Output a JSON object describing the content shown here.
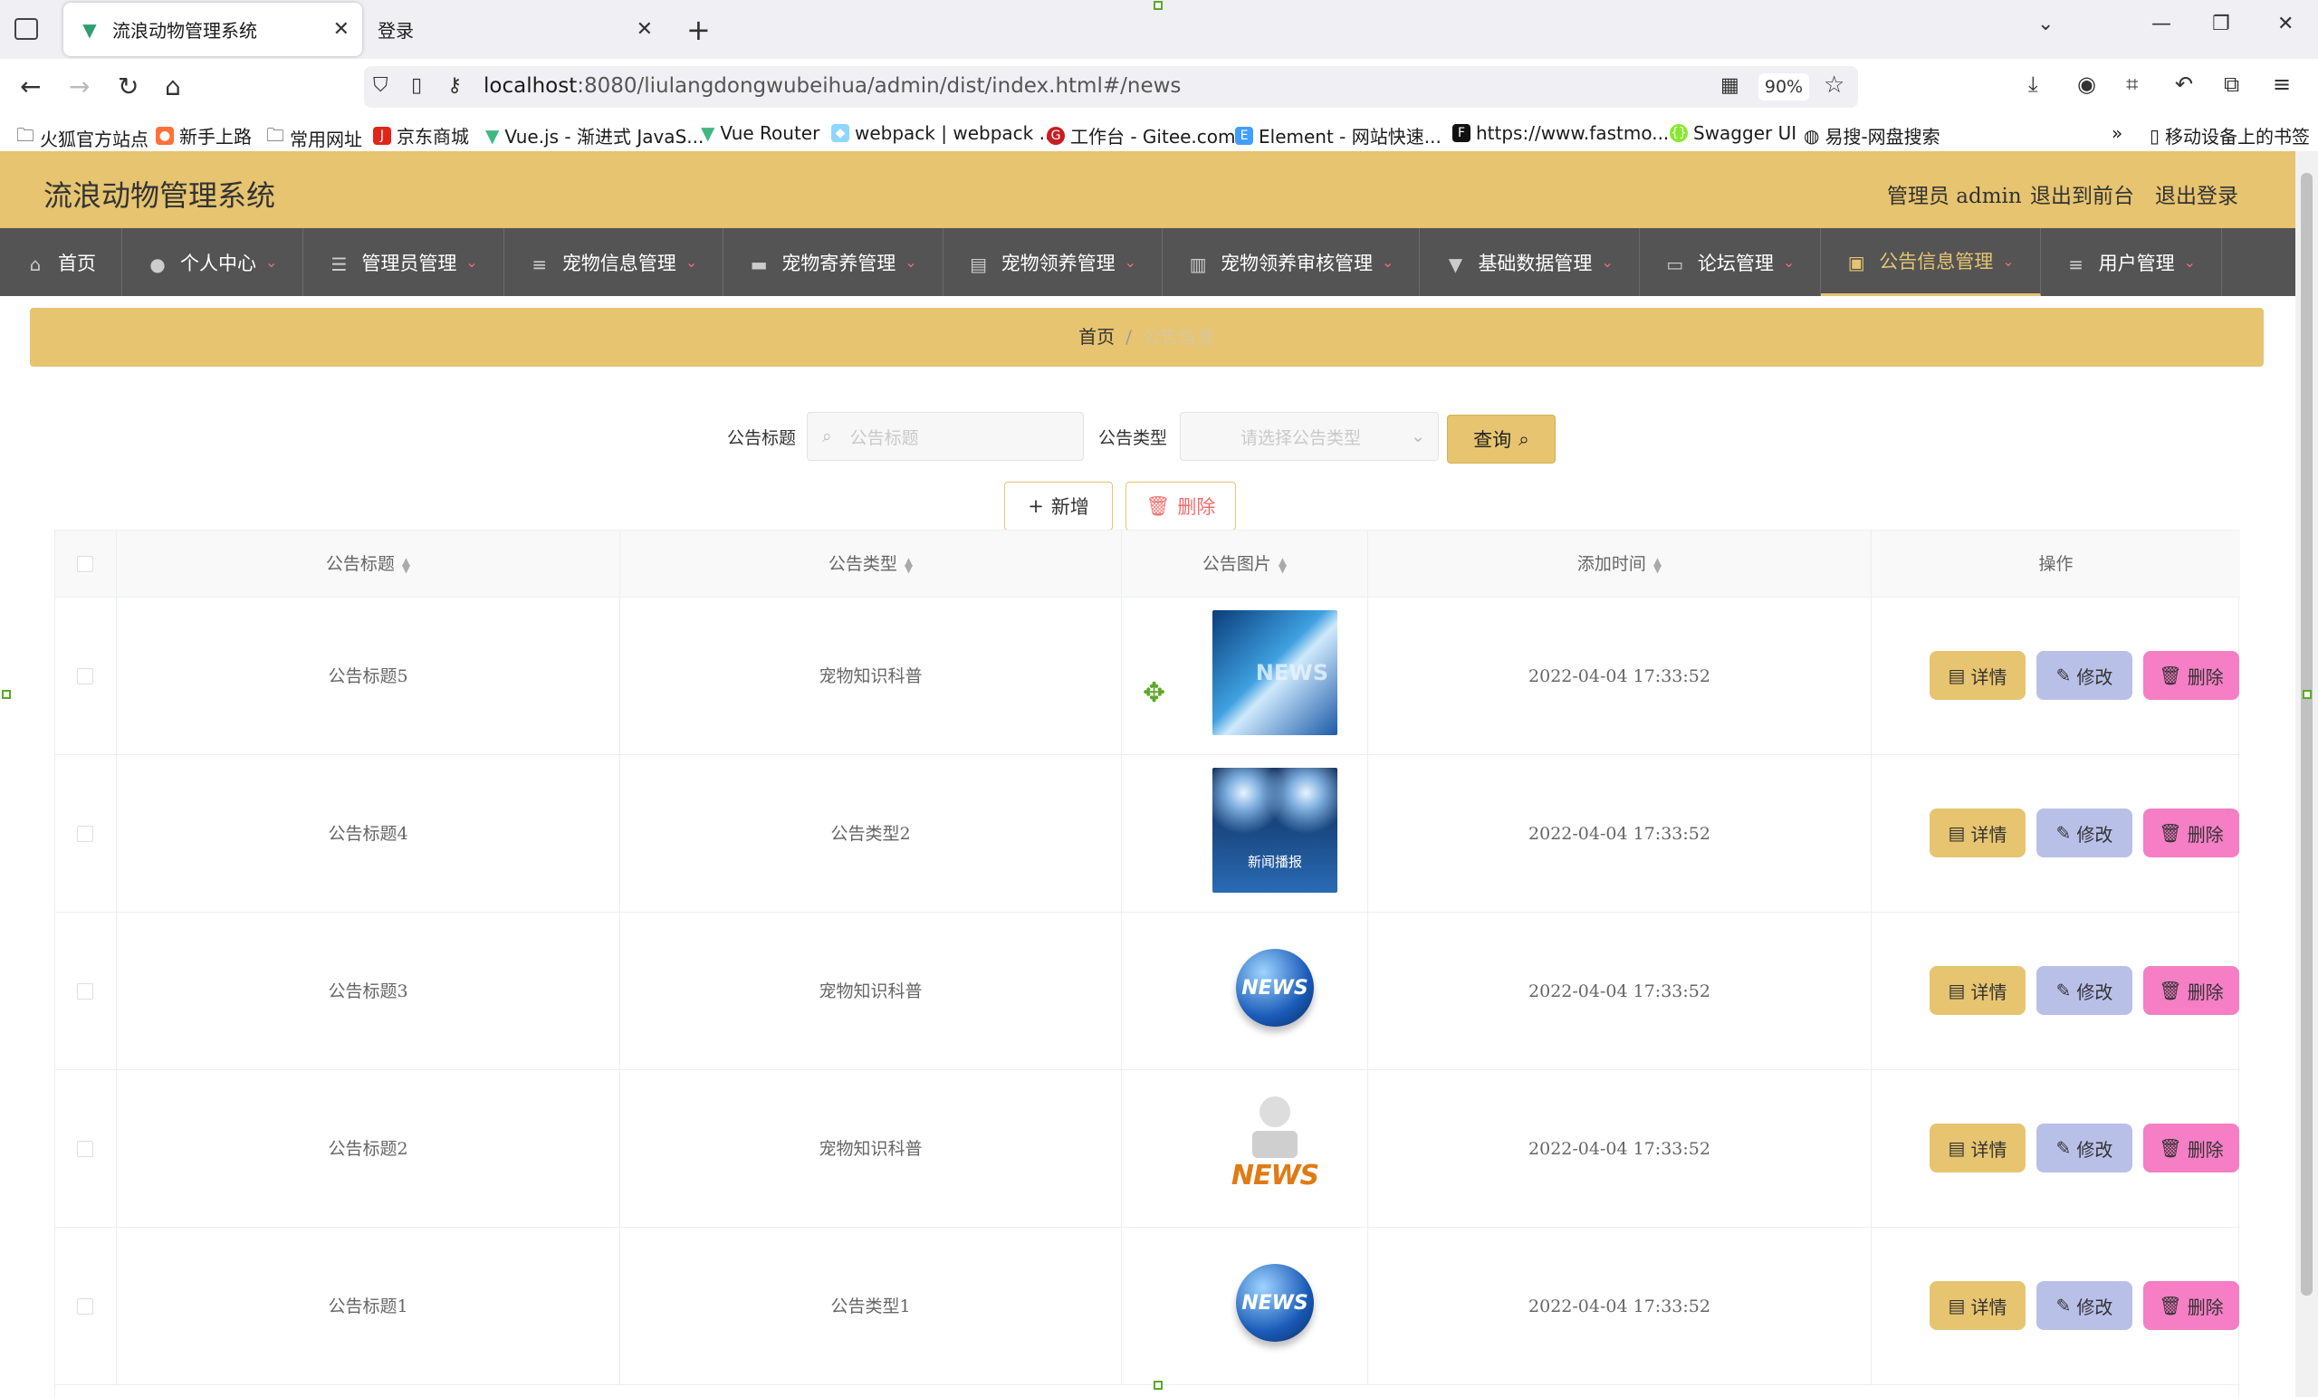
{
  "browser": {
    "tabs": [
      {
        "title": "流浪动物管理系统"
      },
      {
        "title": "登录"
      }
    ],
    "url_host": "localhost",
    "url_rest": ":8080/liulangdongwubeihua/admin/dist/index.html#/news",
    "zoom": "90%",
    "bookmarks": [
      "火狐官方站点",
      "新手上路",
      "常用网址",
      "京东商城",
      "Vue.js - 渐进式 JavaS...",
      "Vue Router",
      "webpack | webpack ...",
      "工作台 - Gitee.com",
      "Element - 网站快速...",
      "https://www.fastmo...",
      "Swagger UI",
      "易搜-网盘搜索"
    ],
    "mobile_bookmarks": "移动设备上的书签"
  },
  "header": {
    "brand": "流浪动物管理系统",
    "user": "管理员 admin",
    "front": "退出到前台",
    "logout": "退出登录"
  },
  "menu": [
    {
      "label": "首页",
      "icon": "home-icon"
    },
    {
      "label": "个人中心",
      "icon": "user-icon"
    },
    {
      "label": "管理员管理",
      "icon": "sliders-icon"
    },
    {
      "label": "宠物信息管理",
      "icon": "list-icon"
    },
    {
      "label": "宠物寄养管理",
      "icon": "ticket-icon"
    },
    {
      "label": "宠物领养管理",
      "icon": "clipboard-icon"
    },
    {
      "label": "宠物领养审核管理",
      "icon": "chart-icon"
    },
    {
      "label": "基础数据管理",
      "icon": "pin-icon"
    },
    {
      "label": "论坛管理",
      "icon": "monitor-icon"
    },
    {
      "label": "公告信息管理",
      "icon": "briefcase-icon"
    },
    {
      "label": "用户管理",
      "icon": "menu-icon"
    }
  ],
  "breadcrumb": {
    "home": "首页",
    "sep": "/",
    "current": "公告信息"
  },
  "search": {
    "title_label": "公告标题",
    "title_placeholder": "公告标题",
    "type_label": "公告类型",
    "type_placeholder": "请选择公告类型",
    "query": "查询"
  },
  "actions": {
    "add": "新增",
    "delete": "删除"
  },
  "table": {
    "columns": [
      "公告标题",
      "公告类型",
      "公告图片",
      "添加时间",
      "操作"
    ],
    "rows": [
      {
        "title": "公告标题5",
        "type": "宠物知识科普",
        "time": "2022-04-04 17:33:52",
        "image": "news-globe-blue"
      },
      {
        "title": "公告标题4",
        "type": "公告类型2",
        "time": "2022-04-04 17:33:52",
        "image": "news-spotlight"
      },
      {
        "title": "公告标题3",
        "type": "宠物知识科普",
        "time": "2022-04-04 17:33:52",
        "image": "news-globe"
      },
      {
        "title": "公告标题2",
        "type": "宠物知识科普",
        "time": "2022-04-04 17:33:52",
        "image": "news-reader"
      },
      {
        "title": "公告标题1",
        "type": "公告类型1",
        "time": "2022-04-04 17:33:52",
        "image": "news-globe"
      }
    ],
    "row_actions": {
      "detail": "详情",
      "edit": "修改",
      "delete": "删除"
    },
    "image_texts": {
      "spotlight": "新闻播报",
      "news": "NEWS"
    }
  }
}
